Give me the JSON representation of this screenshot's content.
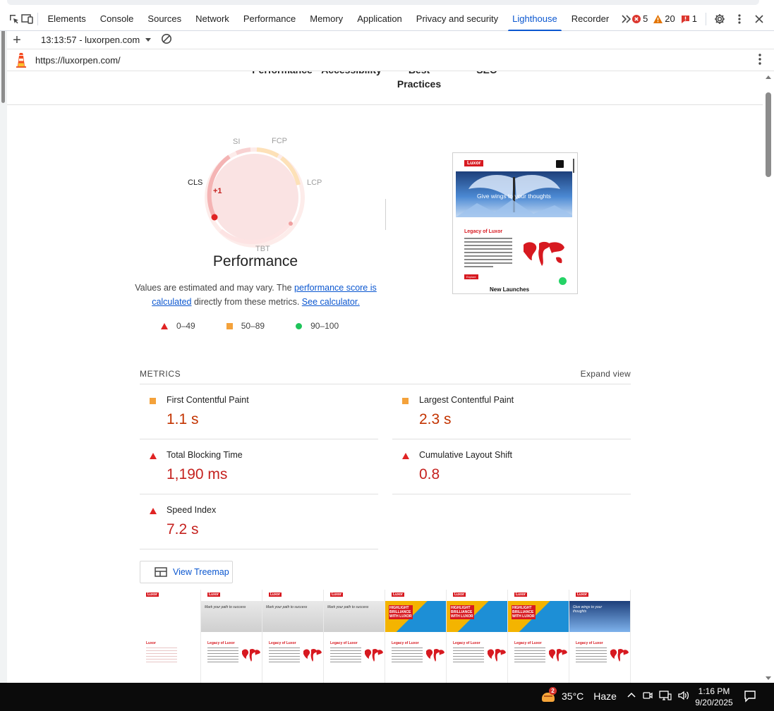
{
  "devtools": {
    "tabs": [
      {
        "label": "Elements"
      },
      {
        "label": "Console"
      },
      {
        "label": "Sources"
      },
      {
        "label": "Network"
      },
      {
        "label": "Performance"
      },
      {
        "label": "Memory"
      },
      {
        "label": "Application"
      },
      {
        "label": "Privacy and security"
      },
      {
        "label": "Lighthouse",
        "active": true
      },
      {
        "label": "Recorder"
      }
    ],
    "errors": "5",
    "warnings": "20",
    "issues": "1"
  },
  "report_bar": {
    "report": "13:13:57 - luxorpen.com"
  },
  "url_bar": {
    "url": "https://luxorpen.com/"
  },
  "gauges_top": {
    "performance": "Performance",
    "accessibility": "Accessibility",
    "best_practices": "Best Practices",
    "seo": "SEO"
  },
  "performance": {
    "title": "Performance",
    "gauge_labels": {
      "si": "SI",
      "fcp": "FCP",
      "lcp": "LCP",
      "tbt": "TBT",
      "cls": "CLS",
      "cls_delta": "+1"
    },
    "note_prefix": "Values are estimated and may vary. The",
    "note_link1": "performance score is calculated",
    "note_mid": "directly from these metrics.",
    "note_link2": "See calculator.",
    "legend": [
      {
        "label": "0–49",
        "shape": "triangle",
        "color": "#e02424"
      },
      {
        "label": "50–89",
        "shape": "square",
        "color": "#f4a23b"
      },
      {
        "label": "90–100",
        "shape": "circle",
        "color": "#1fc45a"
      }
    ]
  },
  "screenshot": {
    "brand": "Luxor",
    "banner_text": "Give wings to your thoughts",
    "section_title": "Legacy of Luxor",
    "cta": "Explore",
    "next_section": "New Launches"
  },
  "metrics": {
    "title": "METRICS",
    "expand": "Expand view",
    "items": [
      {
        "name": "First Contentful Paint",
        "value": "1.1 s",
        "rating": "average"
      },
      {
        "name": "Largest Contentful Paint",
        "value": "2.3 s",
        "rating": "average"
      },
      {
        "name": "Total Blocking Time",
        "value": "1,190 ms",
        "rating": "fail"
      },
      {
        "name": "Cumulative Layout Shift",
        "value": "0.8",
        "rating": "fail"
      },
      {
        "name": "Speed Index",
        "value": "7.2 s",
        "rating": "fail"
      }
    ]
  },
  "treemap": {
    "label": "View Treemap"
  },
  "filmstrip": {
    "frames": [
      {
        "kind": "blank",
        "brand": "Luxor",
        "section": "Luxor"
      },
      {
        "kind": "runner",
        "brand": "Luxor",
        "headline": "Mark your path to success",
        "section": "Legacy of Luxor"
      },
      {
        "kind": "runner",
        "brand": "Luxor",
        "headline": "Mark your path to success",
        "section": "Legacy of Luxor"
      },
      {
        "kind": "runner",
        "brand": "Luxor",
        "headline": "Mark your path to success",
        "section": "Legacy of Luxor"
      },
      {
        "kind": "highlight",
        "brand": "Luxor",
        "headline": "HIGHLIGHT BRILLIANCE WITH LUXOR",
        "section": "Legacy of Luxor"
      },
      {
        "kind": "highlight",
        "brand": "Luxor",
        "headline": "HIGHLIGHT BRILLIANCE WITH LUXOR",
        "section": "Legacy of Luxor"
      },
      {
        "kind": "highlight",
        "brand": "Luxor",
        "headline": "HIGHLIGHT BRILLIANCE WITH LUXOR",
        "section": "Legacy of Luxor"
      },
      {
        "kind": "wings",
        "brand": "Luxor",
        "headline": "Give wings to your thoughts",
        "section": "Legacy of Luxor"
      }
    ]
  },
  "taskbar": {
    "weather_badge": "2",
    "temperature": "35°C",
    "condition": "Haze",
    "time": "1:16 PM",
    "date": "9/20/2025"
  }
}
